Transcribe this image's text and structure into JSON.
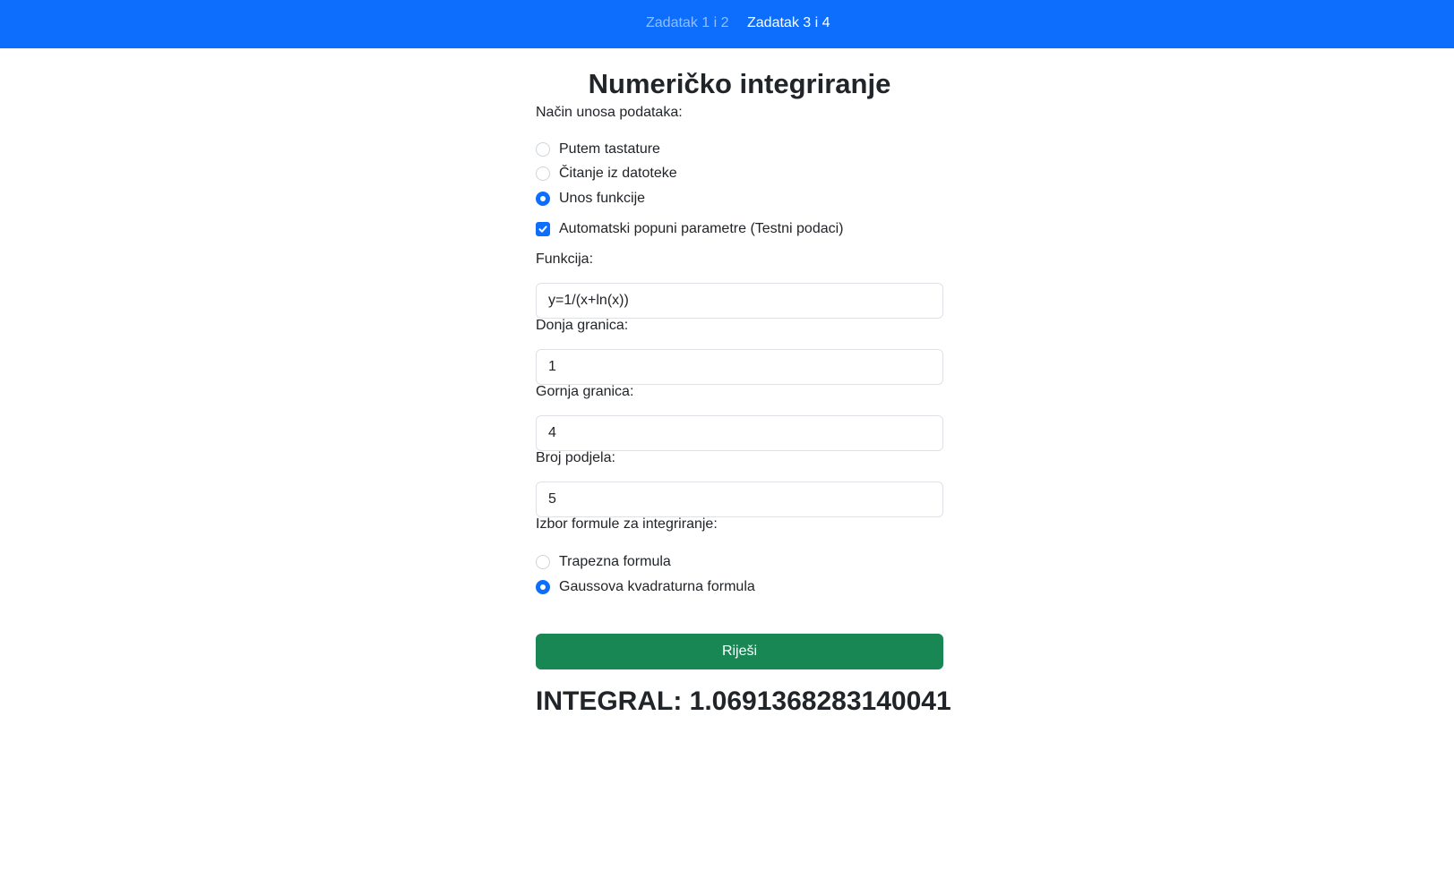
{
  "nav": {
    "items": [
      {
        "label": "Zadatak 1 i 2",
        "active": false
      },
      {
        "label": "Zadatak 3 i 4",
        "active": true
      }
    ]
  },
  "page": {
    "title": "Numeričko integriranje"
  },
  "input_mode": {
    "label": "Način unosa podataka:",
    "options": [
      {
        "label": "Putem tastature",
        "checked": false
      },
      {
        "label": "Čitanje iz datoteke",
        "checked": false
      },
      {
        "label": "Unos funkcije",
        "checked": true
      }
    ]
  },
  "autofill": {
    "label": "Automatski popuni parametre (Testni podaci)",
    "checked": true
  },
  "fields": {
    "function": {
      "label": "Funkcija:",
      "value": "y=1/(x+ln(x))"
    },
    "lower": {
      "label": "Donja granica:",
      "value": "1"
    },
    "upper": {
      "label": "Gornja granica:",
      "value": "4"
    },
    "divisions": {
      "label": "Broj podjela:",
      "value": "5"
    }
  },
  "formula": {
    "label": "Izbor formule za integriranje:",
    "options": [
      {
        "label": "Trapezna formula",
        "checked": false
      },
      {
        "label": "Gaussova kvadraturna formula",
        "checked": true
      }
    ]
  },
  "solve_button": {
    "label": "Riješi"
  },
  "result": {
    "text": "INTEGRAL: 1.0691368283140041"
  },
  "colors": {
    "navbar": "#0d6efd",
    "accent": "#0d6efd",
    "success": "#198754"
  }
}
